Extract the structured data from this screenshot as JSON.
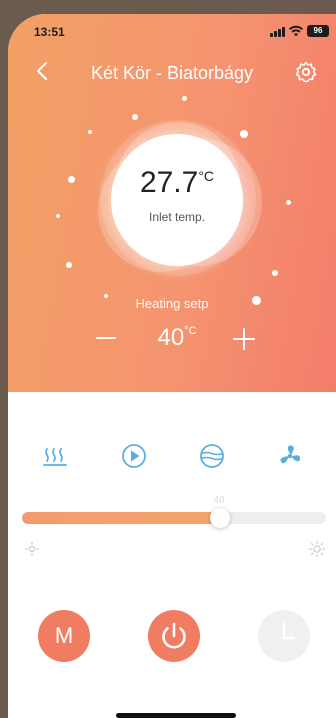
{
  "status_bar": {
    "time": "13:51",
    "battery": "96"
  },
  "header": {
    "title": "Két Kör - Biatorbágy"
  },
  "inlet": {
    "value": "27.7",
    "unit": "°C",
    "label": "Inlet temp."
  },
  "setpoint": {
    "label": "Heating setp",
    "value": "40",
    "unit": "°C"
  },
  "modes": [
    "heating-icon",
    "play-icon",
    "cool-icon",
    "fan-icon"
  ],
  "slider": {
    "value_label": "40",
    "level_fraction": 0.65
  },
  "buttons": {
    "mode_label": "M"
  },
  "colors": {
    "accent": "#f07d62",
    "mode_blue": "#5aaee0",
    "hero_start": "#f2a064",
    "hero_end": "#f37d6a"
  }
}
